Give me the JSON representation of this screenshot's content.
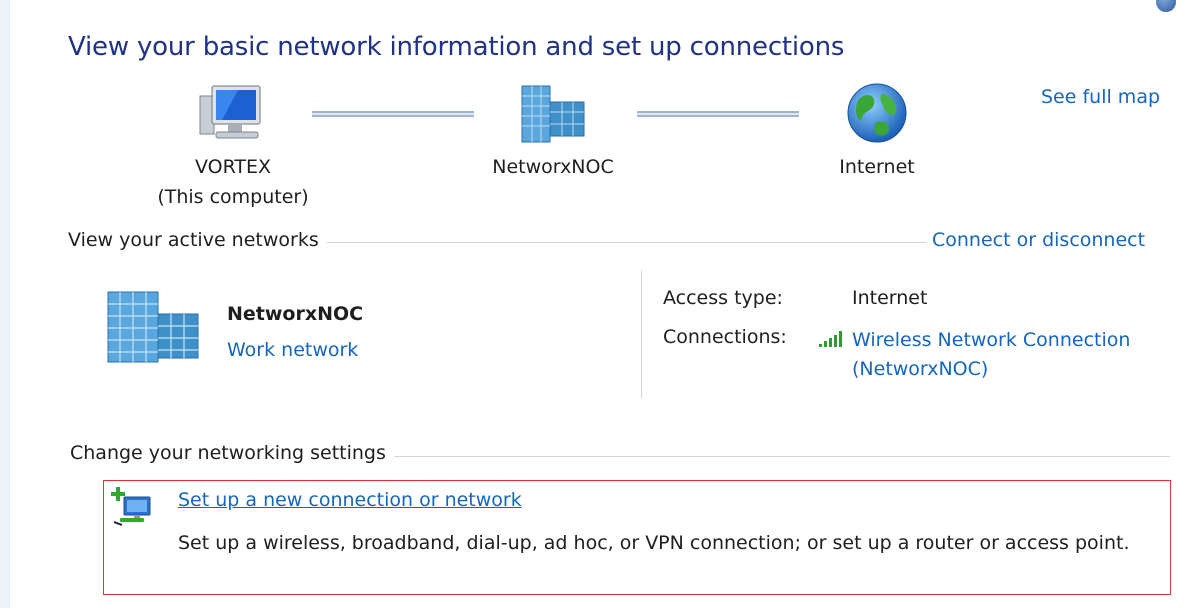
{
  "page": {
    "title": "View your basic network information and set up connections",
    "see_full_map": "See full map"
  },
  "network_map": {
    "computer": {
      "name": "VORTEX",
      "subtitle": "(This computer)",
      "icon": "computer-icon"
    },
    "network": {
      "name": "NetworxNOC",
      "icon": "network-building-icon"
    },
    "internet": {
      "name": "Internet",
      "icon": "globe-icon"
    }
  },
  "active_networks": {
    "heading": "View your active networks",
    "connect_link": "Connect or disconnect",
    "network_name": "NetworxNOC",
    "network_type": "Work network",
    "access_type_label": "Access type:",
    "access_type_value": "Internet",
    "connections_label": "Connections:",
    "connection_line1": "Wireless Network Connection",
    "connection_line2": "(NetworxNOC)",
    "signal_icon": "wireless-signal-icon"
  },
  "settings": {
    "heading": "Change your networking settings",
    "task_title": "Set up a new connection or network",
    "task_description": "Set up a wireless, broadband, dial-up, ad hoc, or VPN connection; or set up a router or access point.",
    "task_icon": "new-connection-icon"
  },
  "colors": {
    "title": "#1e3287",
    "link": "#1565c0",
    "highlight_border": "#e03030"
  }
}
